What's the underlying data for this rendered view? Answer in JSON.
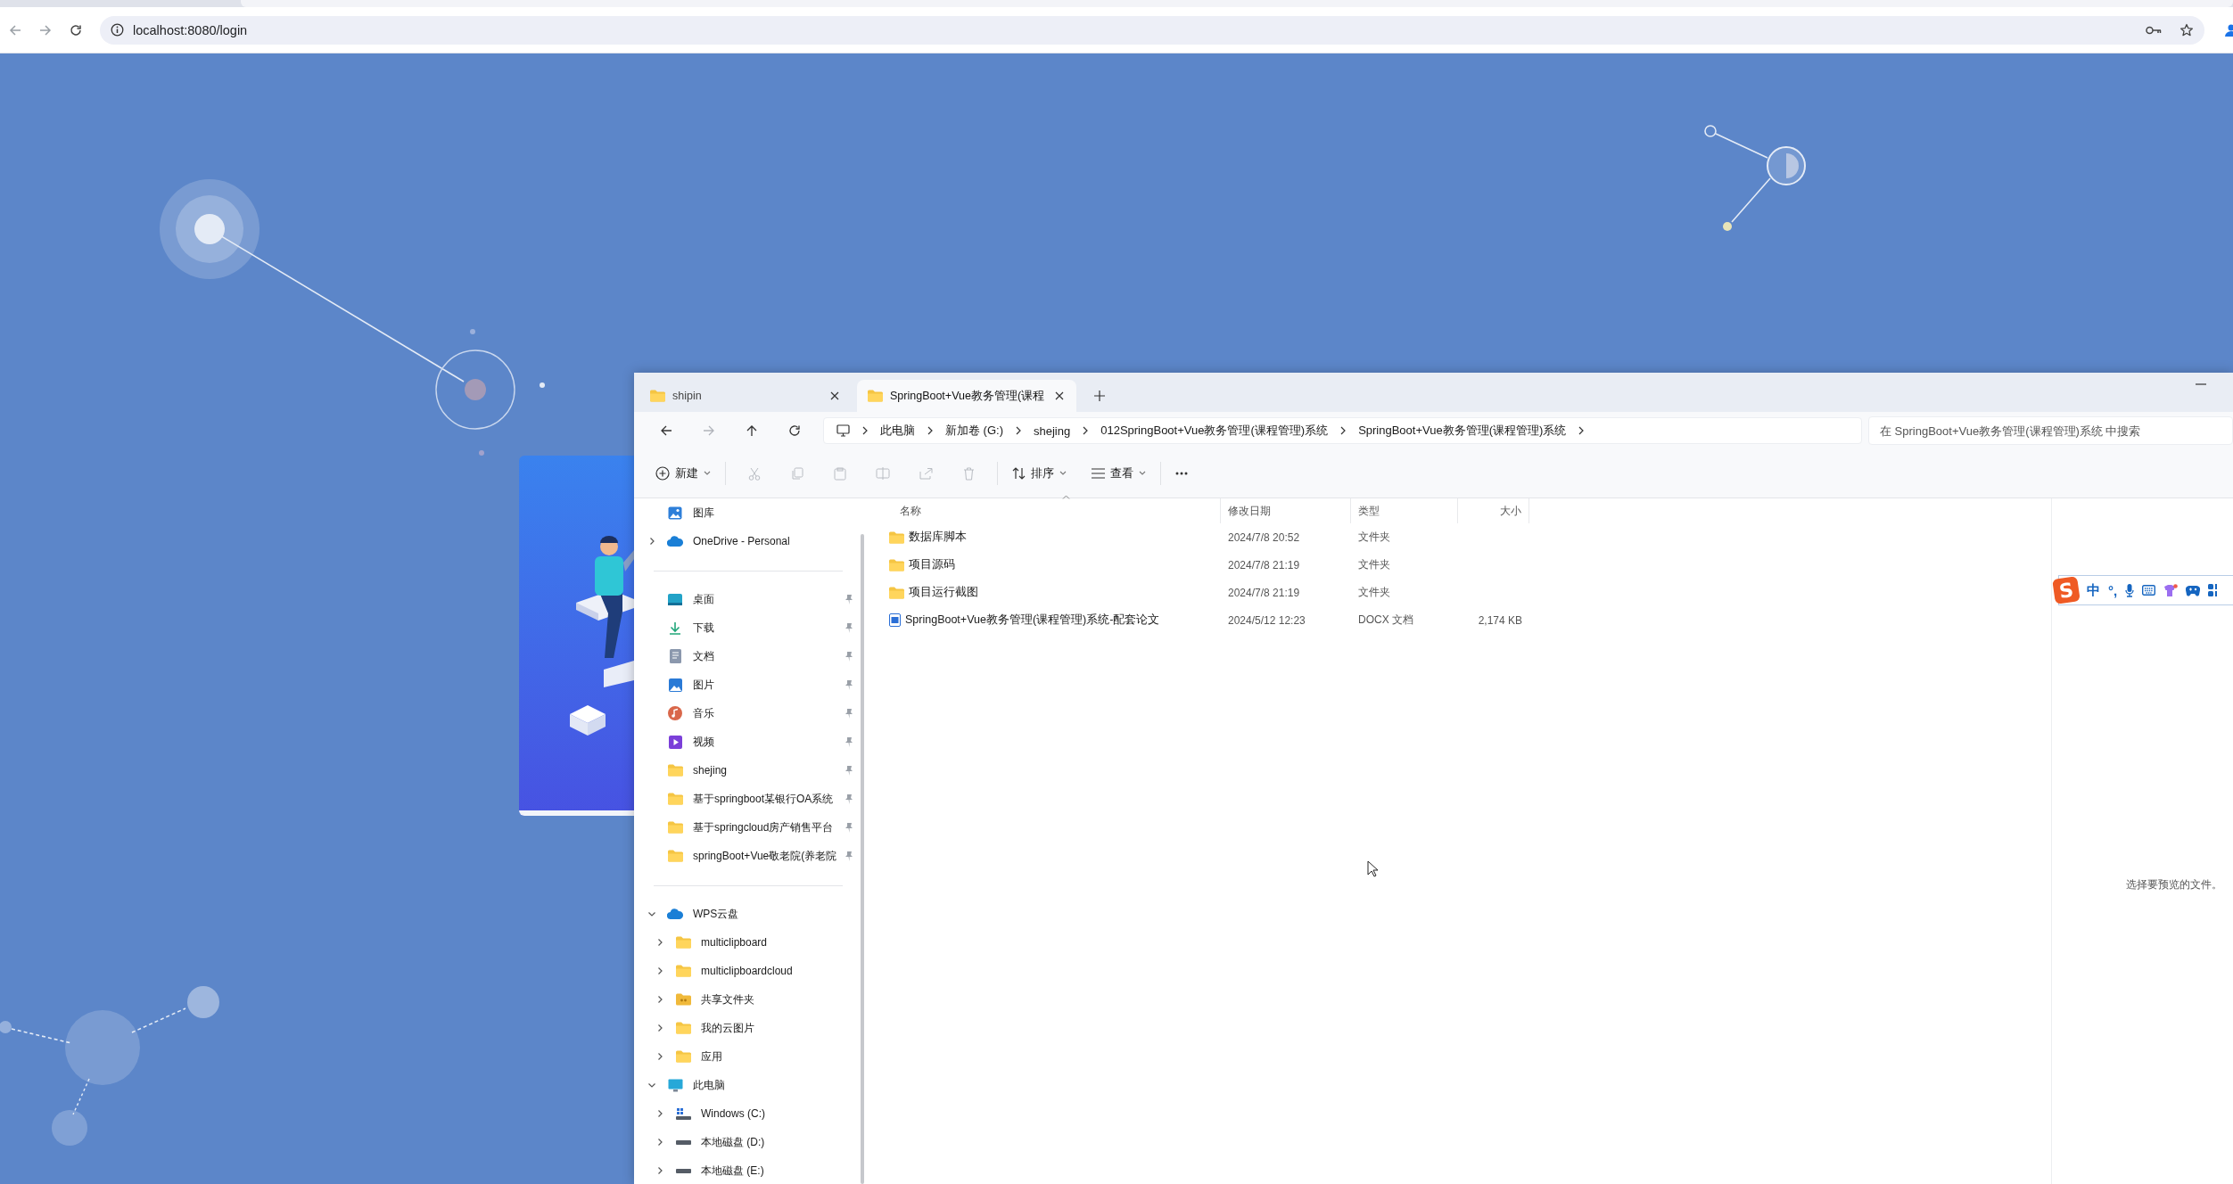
{
  "browser": {
    "url": "localhost:8080/login"
  },
  "explorer": {
    "tabs": [
      {
        "label": "shipin",
        "selected": false
      },
      {
        "label": "SpringBoot+Vue教务管理(课程",
        "selected": true
      }
    ],
    "breadcrumb": [
      "此电脑",
      "新加卷 (G:)",
      "shejing",
      "012SpringBoot+Vue教务管理(课程管理)系统",
      "SpringBoot+Vue教务管理(课程管理)系统"
    ],
    "search": {
      "placeholder": "在 SpringBoot+Vue教务管理(课程管理)系统 中搜索"
    },
    "toolbar": {
      "new": "新建",
      "sort": "排序",
      "view": "查看"
    },
    "sidebar": {
      "top": [
        {
          "kind": "gallery",
          "label": "图库"
        },
        {
          "kind": "cloud",
          "label": "OneDrive - Personal",
          "expanded": false
        }
      ],
      "quick_access": [
        {
          "kind": "desktop",
          "label": "桌面",
          "pinned": true
        },
        {
          "kind": "download",
          "label": "下载",
          "pinned": true
        },
        {
          "kind": "documents",
          "label": "文档",
          "pinned": true
        },
        {
          "kind": "pictures",
          "label": "图片",
          "pinned": true
        },
        {
          "kind": "music",
          "label": "音乐",
          "pinned": true
        },
        {
          "kind": "videos",
          "label": "视频",
          "pinned": true
        },
        {
          "kind": "folder",
          "label": "shejing",
          "pinned": true
        },
        {
          "kind": "folder",
          "label": "基于springboot某银行OA系统",
          "pinned": true
        },
        {
          "kind": "folder",
          "label": "基于springcloud房产销售平台",
          "pinned": true
        },
        {
          "kind": "folder",
          "label": "springBoot+Vue敬老院(养老院",
          "pinned": true
        }
      ],
      "tree": [
        {
          "kind": "cloud",
          "label": "WPS云盘",
          "expanded": true,
          "children": [
            {
              "kind": "folder",
              "label": "multiclipboard",
              "expanded": false
            },
            {
              "kind": "folder",
              "label": "multiclipboardcloud",
              "expanded": false
            },
            {
              "kind": "shared-folder",
              "label": "共享文件夹",
              "expanded": false
            },
            {
              "kind": "folder",
              "label": "我的云图片",
              "expanded": false
            },
            {
              "kind": "folder",
              "label": "应用",
              "expanded": false
            }
          ]
        },
        {
          "kind": "pc",
          "label": "此电脑",
          "expanded": true,
          "children": [
            {
              "kind": "windows-drive",
              "label": "Windows (C:)",
              "expanded": false
            },
            {
              "kind": "drive",
              "label": "本地磁盘 (D:)",
              "expanded": false
            },
            {
              "kind": "drive",
              "label": "本地磁盘 (E:)",
              "expanded": false
            }
          ]
        }
      ]
    },
    "columns": [
      "名称",
      "修改日期",
      "类型",
      "大小"
    ],
    "files": [
      {
        "kind": "folder",
        "name": "数据库脚本",
        "date": "2024/7/8 20:52",
        "type": "文件夹"
      },
      {
        "kind": "folder",
        "name": "项目源码",
        "date": "2024/7/8 21:19",
        "type": "文件夹"
      },
      {
        "kind": "folder",
        "name": "项目运行截图",
        "date": "2024/7/8 21:19",
        "type": "文件夹"
      },
      {
        "kind": "docx",
        "name": "SpringBoot+Vue教务管理(课程管理)系统-配套论文",
        "date": "2024/5/12 12:23",
        "type": "DOCX 文档",
        "size": "2,174 KB"
      }
    ],
    "preview": {
      "message": "选择要预览的文件。"
    }
  },
  "ime": {
    "logo": "S",
    "mode": "中",
    "punctuation": "°,"
  }
}
